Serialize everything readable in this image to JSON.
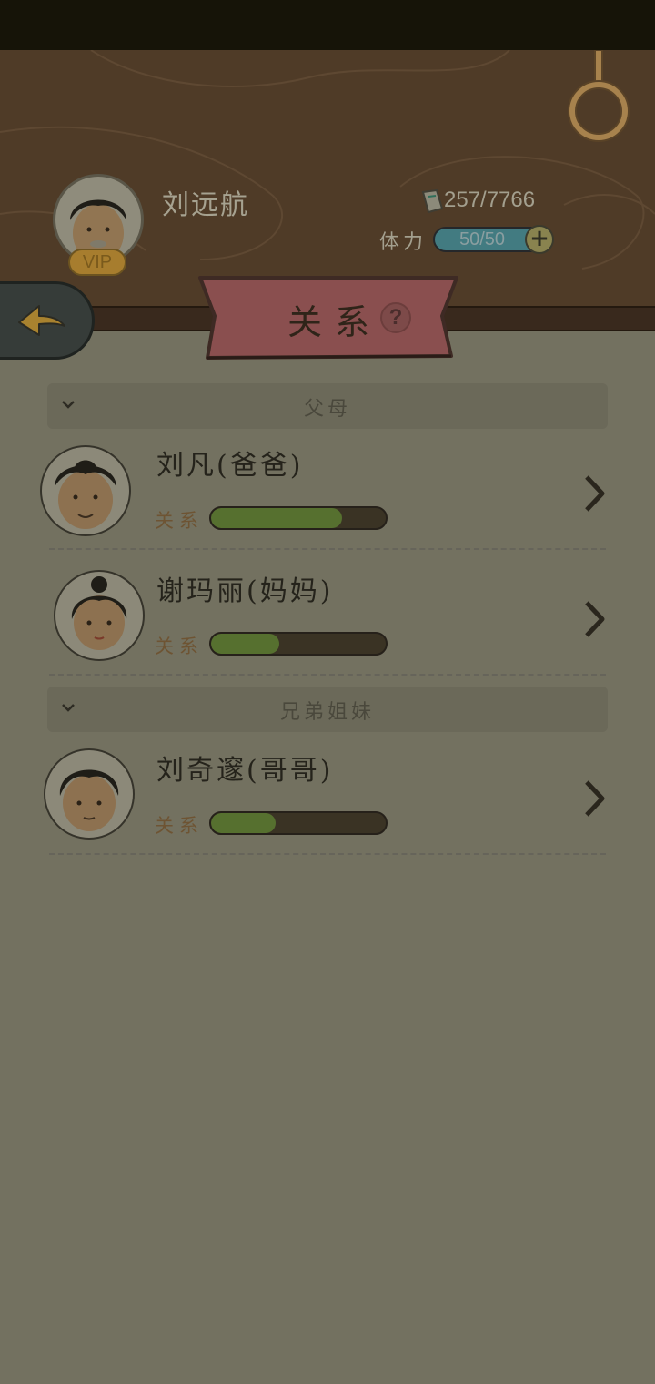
{
  "player": {
    "name": "刘远航",
    "vip_label": "VIP",
    "currency": "257/7766",
    "stamina_label": "体力",
    "stamina_value": "50/50",
    "stamina_add_label": "+"
  },
  "page": {
    "title": "关系",
    "help_label": "?"
  },
  "sections": [
    {
      "title": "父母",
      "members": [
        {
          "name": "刘凡(爸爸)",
          "relation_label": "关系",
          "relation_level": 0.75
        },
        {
          "name": "谢玛丽(妈妈)",
          "relation_label": "关系",
          "relation_level": 0.39
        }
      ]
    },
    {
      "title": "兄弟姐妹",
      "members": [
        {
          "name": "刘奇邃(哥哥)",
          "relation_label": "关系",
          "relation_level": 0.37
        }
      ]
    }
  ],
  "colors": {
    "header_bg": "#4f3b27",
    "body_bg": "#737160",
    "banner": "#8a4f4f",
    "relation_fill": "#56702f",
    "stamina_bar": "#427b81"
  },
  "icons": {
    "back": "arrow-left-icon",
    "expand": "chevron-down-icon",
    "detail": "chevron-right-icon",
    "currency": "scroll-icon",
    "settings": "ring-hook-icon"
  }
}
